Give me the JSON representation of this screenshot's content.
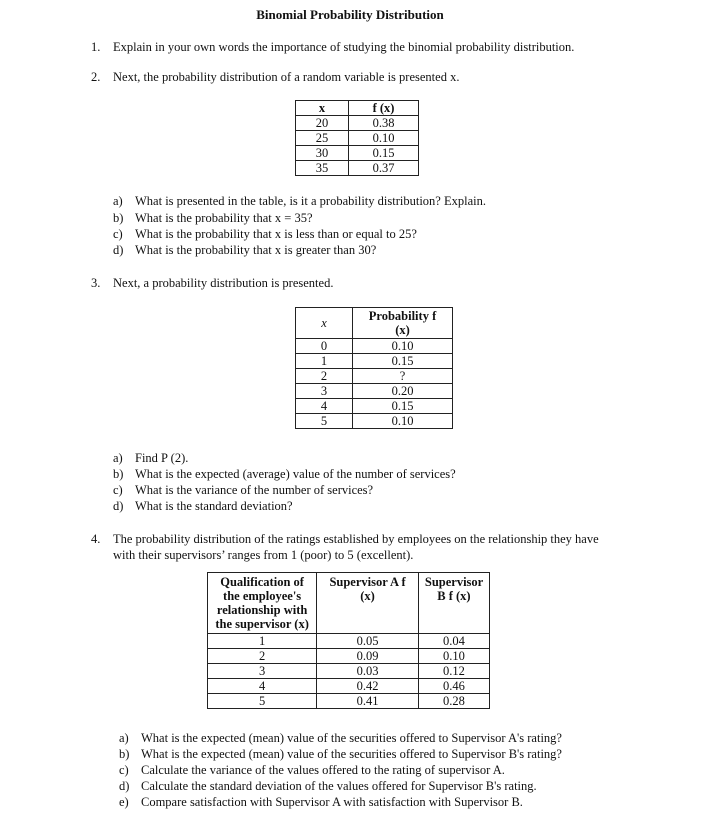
{
  "title": "Binomial Probability Distribution",
  "questions": [
    {
      "number": "1.",
      "text": "Explain in your own words the importance of studying the binomial probability distribution."
    },
    {
      "number": "2.",
      "text": "Next, the probability distribution of a random variable is presented x.",
      "table": {
        "headers": [
          "x",
          "f (x)"
        ],
        "rows": [
          [
            "20",
            "0.38"
          ],
          [
            "25",
            "0.10"
          ],
          [
            "30",
            "0.15"
          ],
          [
            "35",
            "0.37"
          ]
        ]
      },
      "subs": [
        {
          "label": "a)",
          "text": "What is presented in the table, is it a probability distribution? Explain."
        },
        {
          "label": "b)",
          "text": "What is the probability that x = 35?"
        },
        {
          "label": "c)",
          "text": "What is the probability that x is less than or equal to 25?"
        },
        {
          "label": "d)",
          "text": "What is the probability that x is greater than 30?"
        }
      ]
    },
    {
      "number": "3.",
      "text": "Next, a probability distribution is presented.",
      "table": {
        "headers": [
          "x",
          "Probability f (x)"
        ],
        "rows": [
          [
            "0",
            "0.10"
          ],
          [
            "1",
            "0.15"
          ],
          [
            "2",
            "?"
          ],
          [
            "3",
            "0.20"
          ],
          [
            "4",
            "0.15"
          ],
          [
            "5",
            "0.10"
          ]
        ]
      },
      "subs": [
        {
          "label": "a)",
          "text": "Find P (2)."
        },
        {
          "label": "b)",
          "text": "What is the expected (average) value of the number of services?"
        },
        {
          "label": "c)",
          "text": "What is the variance of the number of services?"
        },
        {
          "label": "d)",
          "text": "What is the standard deviation?"
        }
      ]
    },
    {
      "number": "4.",
      "text_line1": "The probability distribution of the ratings established by employees on the relationship they have",
      "text_line2": "with their supervisors’ ranges from 1 (poor) to 5 (excellent).",
      "table": {
        "headers": [
          "Qualification of the employee's relationship with the supervisor (x)",
          "Supervisor A f (x)",
          "Supervisor B f (x)"
        ],
        "rows": [
          [
            "1",
            "0.05",
            "0.04"
          ],
          [
            "2",
            "0.09",
            "0.10"
          ],
          [
            "3",
            "0.03",
            "0.12"
          ],
          [
            "4",
            "0.42",
            "0.46"
          ],
          [
            "5",
            "0.41",
            "0.28"
          ]
        ]
      },
      "subs": [
        {
          "label": "a)",
          "text": "What is the expected (mean) value of the securities offered to Supervisor A's rating?"
        },
        {
          "label": "b)",
          "text": "What is the expected (mean) value of the securities offered to Supervisor B's rating?"
        },
        {
          "label": "c)",
          "text": "Calculate the variance of the values offered to the rating of supervisor A."
        },
        {
          "label": "d)",
          "text": "Calculate the standard deviation of the values offered for Supervisor B's rating."
        },
        {
          "label": "e)",
          "text": "Compare satisfaction with Supervisor A with satisfaction with Supervisor B."
        }
      ]
    }
  ]
}
